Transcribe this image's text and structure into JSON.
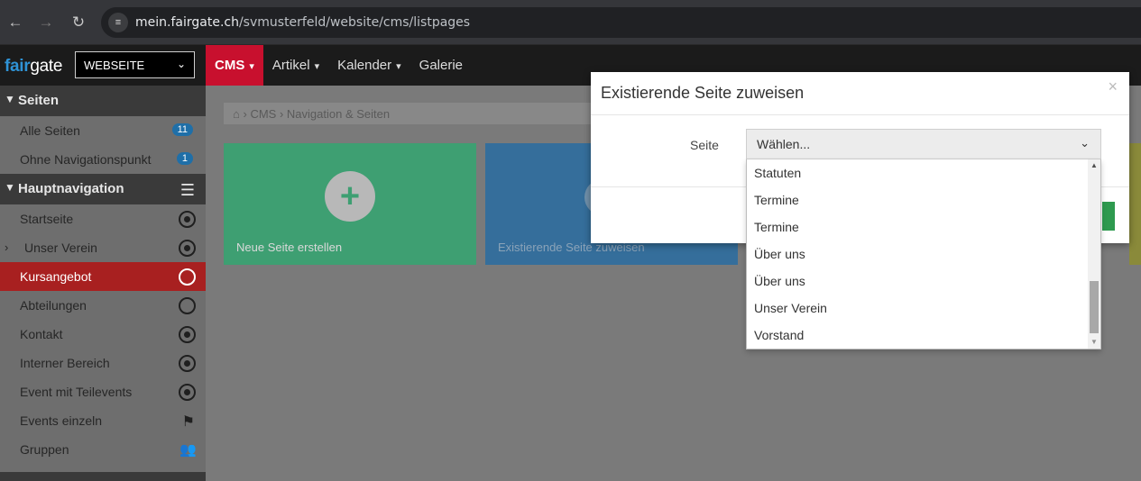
{
  "browser": {
    "url_host": "mein.fairgate.ch",
    "url_path": "/svmusterfeld/website/cms/listpages"
  },
  "app": {
    "logo_a": "fair",
    "logo_b": "gate",
    "site_select": "WEBSEITE"
  },
  "topnav": [
    {
      "label": "CMS"
    },
    {
      "label": "Artikel"
    },
    {
      "label": "Kalender"
    },
    {
      "label": "Galerie"
    }
  ],
  "sidebar": {
    "section_pages": "Seiten",
    "pages": [
      {
        "label": "Alle Seiten",
        "badge": "11"
      },
      {
        "label": "Ohne Navigationspunkt",
        "badge": "1"
      }
    ],
    "section_nav": "Hauptnavigation",
    "nav": [
      {
        "label": "Startseite",
        "icon": "radio-dot-icon"
      },
      {
        "label": "Unser Verein",
        "icon": "radio-dot-icon"
      },
      {
        "label": "Kursangebot",
        "icon": "radio-empty-icon"
      },
      {
        "label": "Abteilungen",
        "icon": "radio-empty-icon"
      },
      {
        "label": "Kontakt",
        "icon": "radio-dot-icon"
      },
      {
        "label": "Interner Bereich",
        "icon": "radio-dot-icon"
      },
      {
        "label": "Event mit Teilevents",
        "icon": "radio-dot-icon"
      },
      {
        "label": "Events einzeln",
        "icon": "flag-icon"
      },
      {
        "label": "Gruppen",
        "icon": "people-icon"
      }
    ]
  },
  "breadcrumb": {
    "items": [
      "CMS",
      "Navigation & Seiten"
    ]
  },
  "tiles": {
    "new_page": "Neue Seite erstellen",
    "assign_page": "Existierende Seite zuweisen"
  },
  "modal": {
    "title": "Existierende Seite zuweisen",
    "field_label": "Seite",
    "select_value": "Wählen...",
    "options": [
      "Statuten",
      "Termine",
      "Termine",
      "Über uns",
      "Über uns",
      "Unser Verein",
      "Vorstand"
    ]
  }
}
